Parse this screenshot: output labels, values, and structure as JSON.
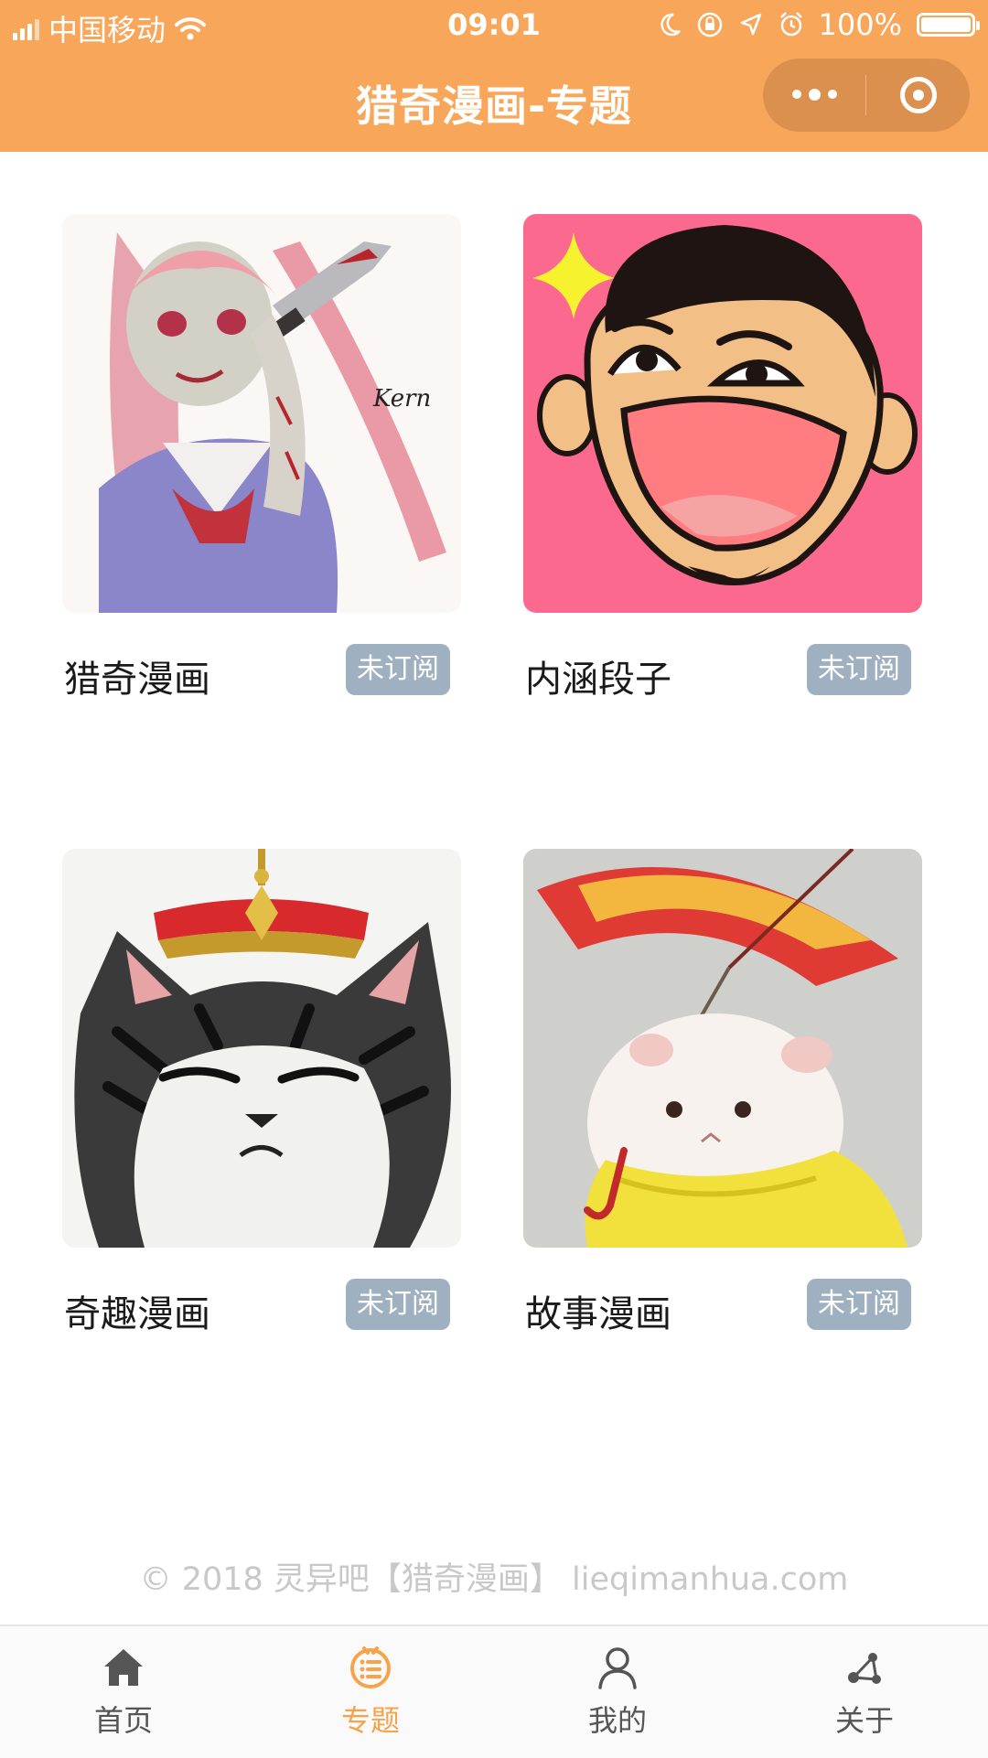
{
  "status_bar": {
    "carrier": "中国移动",
    "time": "09:01",
    "battery": "100%",
    "battery_level": 1.0
  },
  "navbar": {
    "title": "猎奇漫画-专题"
  },
  "cards": [
    {
      "title": "猎奇漫画",
      "badge": "未订阅",
      "image": "anime-girl-with-knife"
    },
    {
      "title": "内涵段子",
      "badge": "未订阅",
      "image": "laughing-cartoon-face"
    },
    {
      "title": "奇趣漫画",
      "badge": "未订阅",
      "image": "grumpy-cat-with-hat"
    },
    {
      "title": "故事漫画",
      "badge": "未订阅",
      "image": "hamster-with-umbrella"
    }
  ],
  "copyright": "© 2018 灵异吧【猎奇漫画】 lieqimanhua.com",
  "tabbar": {
    "active_color": "#f7a349",
    "items": [
      {
        "label": "首页",
        "icon": "home-icon",
        "active": false
      },
      {
        "label": "专题",
        "icon": "topic-list-icon",
        "active": true
      },
      {
        "label": "我的",
        "icon": "user-icon",
        "active": false
      },
      {
        "label": "关于",
        "icon": "about-nodes-icon",
        "active": false
      }
    ]
  },
  "colors": {
    "header": "#f8a65a",
    "badge": "#9fb0c0"
  }
}
